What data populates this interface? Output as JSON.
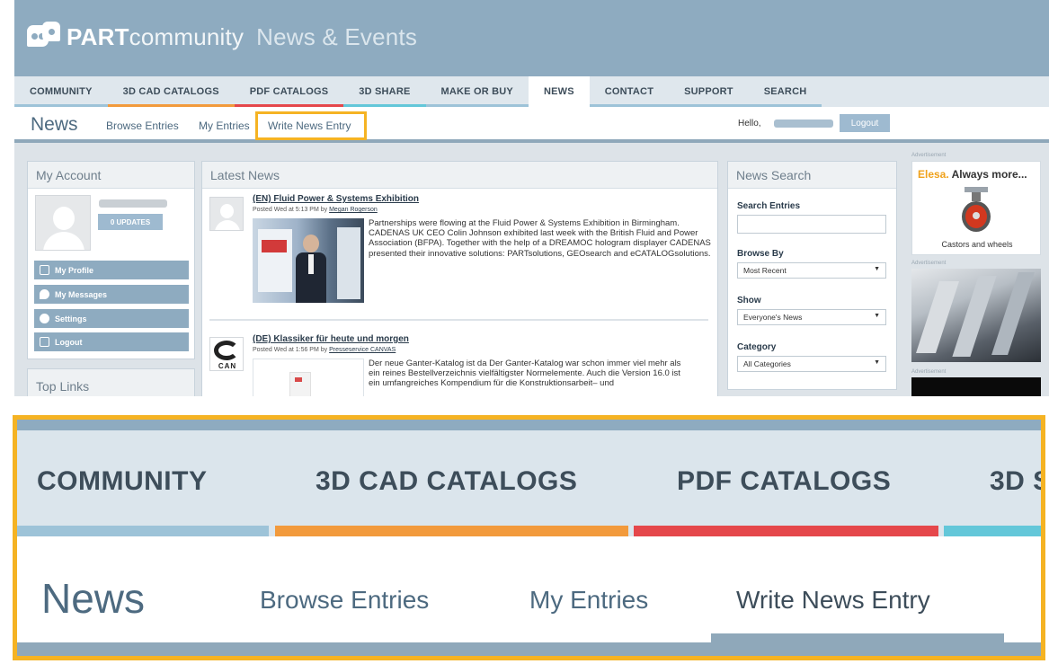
{
  "header": {
    "brand_bold": "PART",
    "brand_light": "community",
    "brand_section": "News & Events"
  },
  "colors": {
    "header_bg": "#8eabc0",
    "nav_bg": "#dfe7ed",
    "highlight": "#f5b323",
    "nav_underlines": [
      "#9dc3d8",
      "#f29a3c",
      "#e5474b",
      "#63c7d9",
      "#9dc3d8",
      "#ffffff",
      "#9dc3d8",
      "#9dc3d8",
      "#9dc3d8"
    ]
  },
  "nav": {
    "items": [
      "COMMUNITY",
      "3D CAD CATALOGS",
      "PDF CATALOGS",
      "3D SHARE",
      "MAKE OR BUY",
      "NEWS",
      "CONTACT",
      "SUPPORT",
      "SEARCH"
    ],
    "active": "NEWS"
  },
  "subnav": {
    "title": "News",
    "links": [
      "Browse Entries",
      "My Entries",
      "Write News Entry"
    ],
    "hello": "Hello,",
    "logout": "Logout"
  },
  "account": {
    "title": "My Account",
    "updates": "0 UPDATES",
    "menu": [
      "My Profile",
      "My Messages",
      "Settings",
      "Logout"
    ],
    "icons": [
      "list-icon",
      "chat-icon",
      "gear-icon",
      "logout-icon"
    ]
  },
  "top_links": {
    "title": "Top Links"
  },
  "latest": {
    "title": "Latest News",
    "items": [
      {
        "title": "(EN) Fluid Power & Systems Exhibition",
        "meta": "Posted Wed at 5:13 PM by",
        "author": "Megan Rogerson",
        "text": "Partnerships were flowing at the Fluid Power & Systems Exhibition in Birmingham. CADENAS UK CEO Colin Johnson exhibited last week with the British Fluid and Power Association (BFPA). Together with the help of a DREAMOC hologram displayer CADENAS presented their innovative solutions: PARTsolutions, GEOsearch and eCATALOGsolutions."
      },
      {
        "title": "(DE) Klassiker für heute und morgen",
        "meta": "Posted Wed at 1:56 PM by",
        "author": "Presseservice CANVAS",
        "logo": "CAN",
        "text": "Der neue Ganter-Katalog ist da Der Ganter-Katalog war schon immer viel mehr als ein reines Bestellverzeichnis vielfältigster Normelemente. Auch die Version 16.0 ist ein umfangreiches Kompendium für die Konstruktionsarbeit– und"
      }
    ]
  },
  "news_search": {
    "title": "News Search",
    "search_label": "Search Entries",
    "browse_label": "Browse By",
    "browse_value": "Most Recent",
    "show_label": "Show",
    "show_value": "Everyone's News",
    "category_label": "Category",
    "category_value": "All Categories"
  },
  "ads": {
    "label": "Advertisement",
    "ad1_brand": "Elesa.",
    "ad1_tagline": "Always more...",
    "ad1_caption": "Castors and wheels"
  },
  "zoom": {
    "nav_items": [
      "COMMUNITY",
      "3D CAD CATALOGS",
      "PDF CATALOGS",
      "3D S"
    ],
    "underline_colors": [
      "#9dc3d8",
      "#f29a3c",
      "#e5474b",
      "#63c7d9"
    ],
    "title": "News",
    "links": [
      "Browse Entries",
      "My Entries",
      "Write News Entry"
    ]
  }
}
